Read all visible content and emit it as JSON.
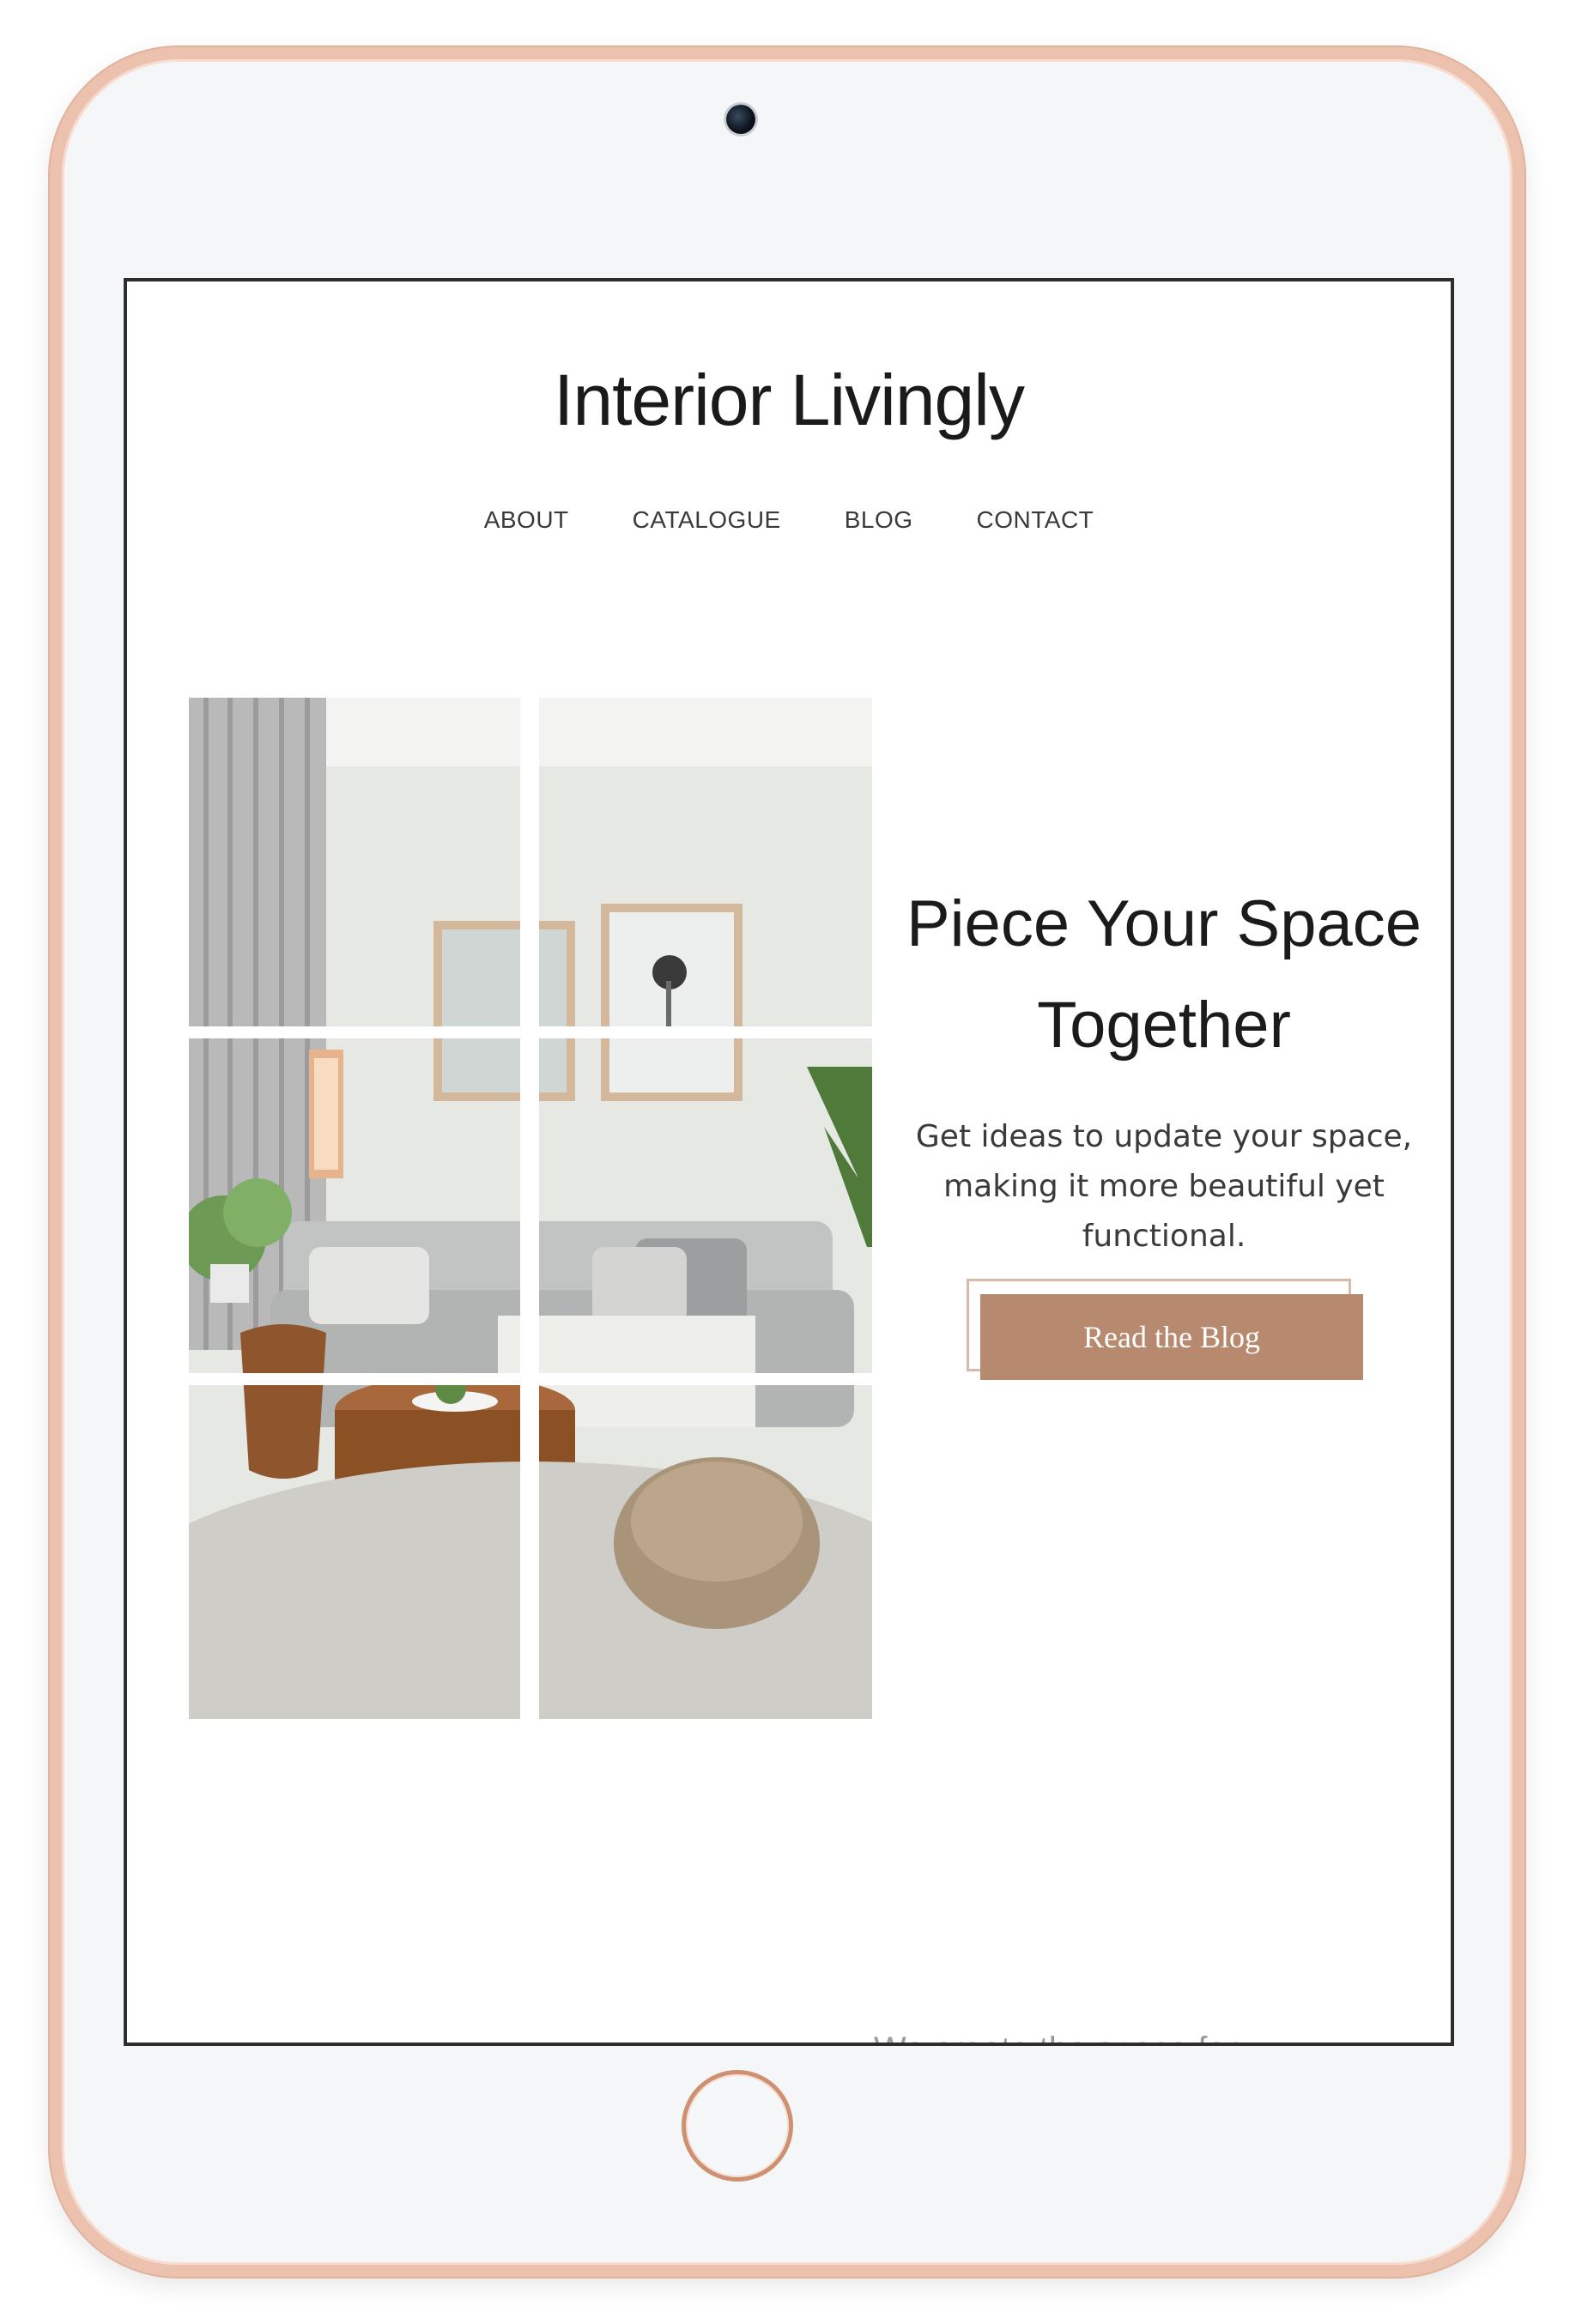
{
  "site": {
    "brand": "Interior Livingly",
    "nav": [
      {
        "label": "ABOUT"
      },
      {
        "label": "CATALOGUE"
      },
      {
        "label": "BLOG"
      },
      {
        "label": "CONTACT"
      }
    ]
  },
  "hero": {
    "headline_line1": "Piece Your Space",
    "headline_line2": "Together",
    "subtext": "Get ideas to update your space, making it more beautiful yet functional.",
    "cta_label": "Read the Blog",
    "image_icon": "living-room-photo"
  },
  "next_section": {
    "left_text_cut": "",
    "right_text_cut": "We create the space for"
  },
  "colors": {
    "accent": "#b78a70",
    "accent_outline": "#d9b9a9",
    "frame": "#ecc2ae",
    "text": "#1b1b1b"
  }
}
